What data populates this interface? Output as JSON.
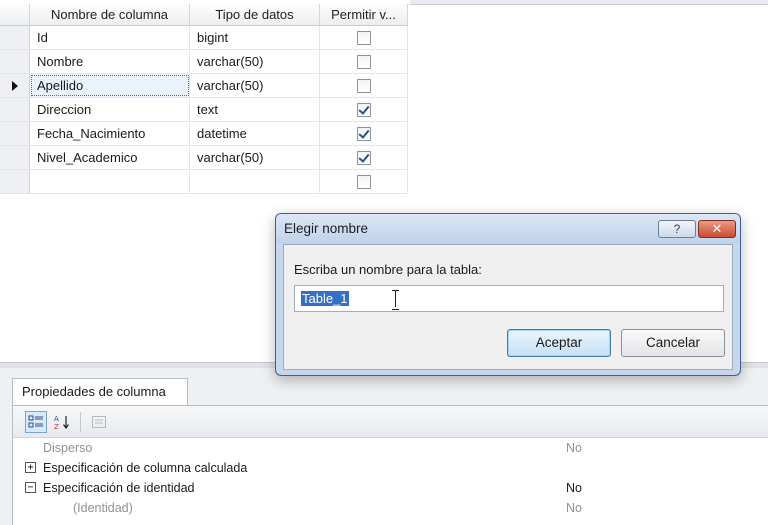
{
  "grid": {
    "headers": {
      "column_name": "Nombre de columna",
      "data_type": "Tipo de datos",
      "allow_nulls": "Permitir v..."
    },
    "rows": [
      {
        "name": "Id",
        "type": "bigint",
        "allow_nulls": false
      },
      {
        "name": "Nombre",
        "type": "varchar(50)",
        "allow_nulls": false
      },
      {
        "name": "Apellido",
        "type": "varchar(50)",
        "allow_nulls": false,
        "current": true
      },
      {
        "name": "Direccion",
        "type": "text",
        "allow_nulls": true
      },
      {
        "name": "Fecha_Nacimiento",
        "type": "datetime",
        "allow_nulls": true
      },
      {
        "name": "Nivel_Academico",
        "type": "varchar(50)",
        "allow_nulls": true
      },
      {
        "name": "",
        "type": "",
        "allow_nulls": false
      }
    ]
  },
  "properties": {
    "tab_label": "Propiedades de columna",
    "toolbar": {
      "categorized_icon": "categorized-icon",
      "sort_az_label": "A↓Z",
      "pages_icon": "property-pages-icon"
    },
    "rows": [
      {
        "name": "Disperso",
        "value": "No",
        "dim": true
      },
      {
        "expander": "+",
        "name": "Especificación de columna calculada",
        "value": ""
      },
      {
        "expander": "−",
        "name": "Especificación de identidad",
        "value": "No"
      },
      {
        "name": "(Identidad)",
        "value": "No",
        "dim": true
      }
    ]
  },
  "dialog": {
    "title": "Elegir nombre",
    "help_label": "?",
    "close_label": "✕",
    "prompt": "Escriba un nombre para la tabla:",
    "table_name_value": "Table_1",
    "ok_label": "Aceptar",
    "cancel_label": "Cancelar"
  }
}
